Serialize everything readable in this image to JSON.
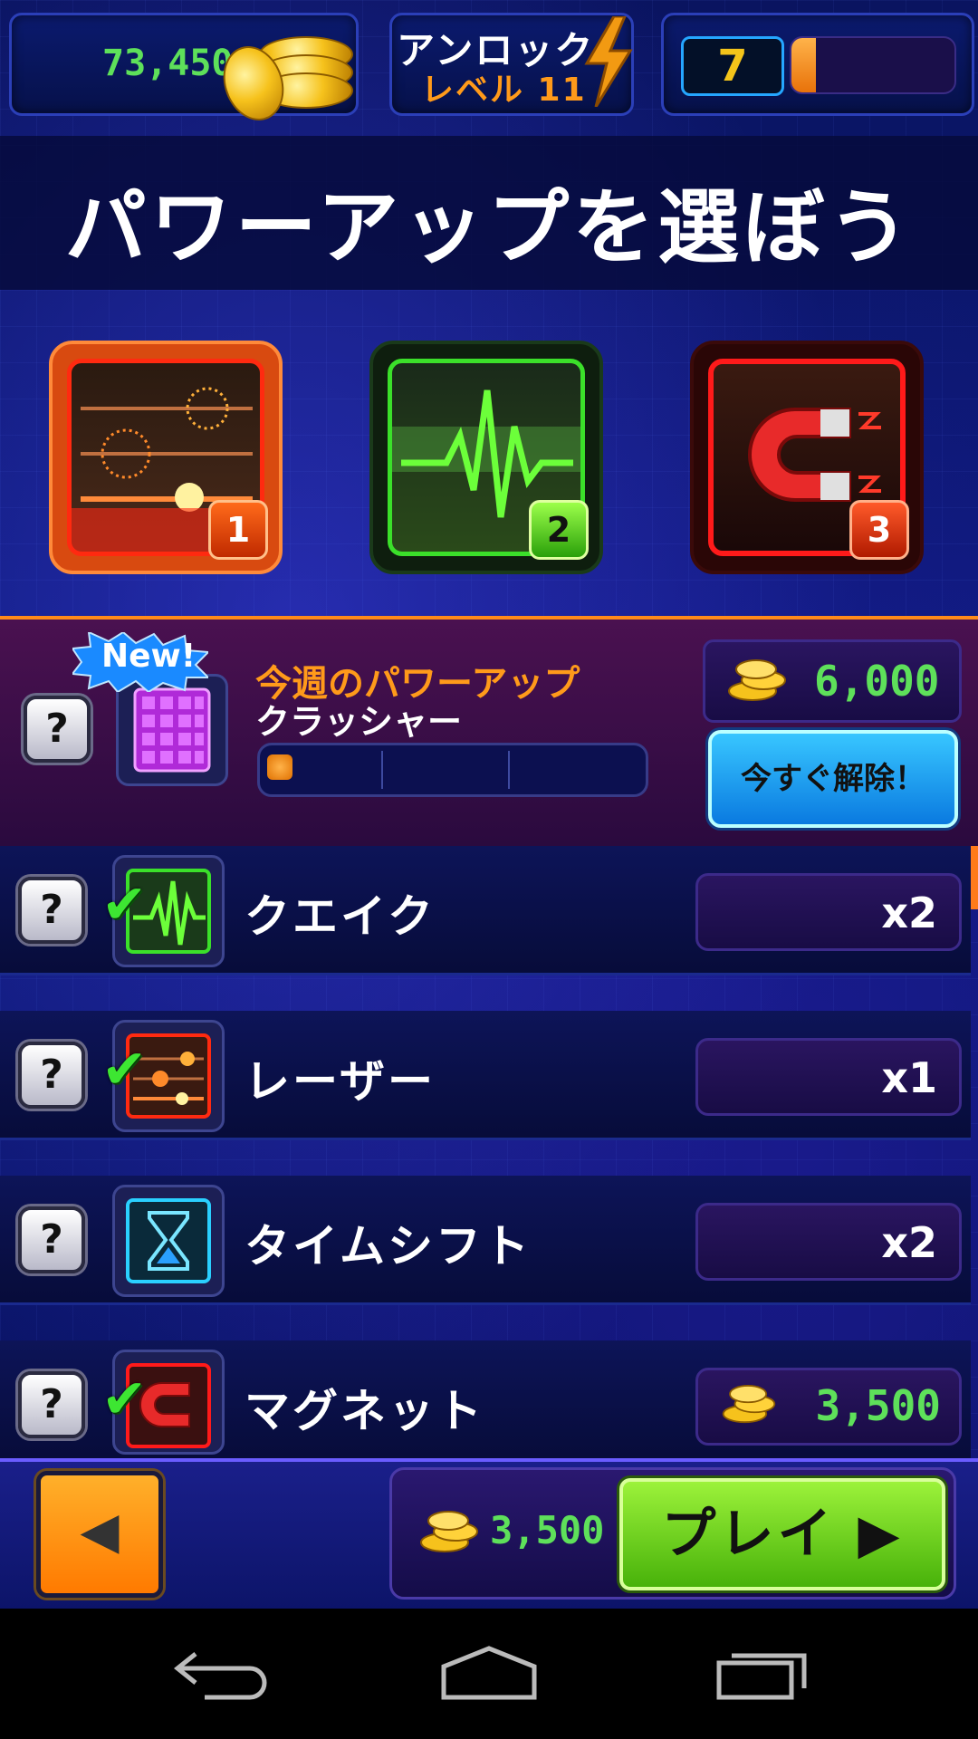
{
  "header": {
    "coins": "73,450",
    "unlock_label": "アンロック",
    "unlock_level": "レベル 11",
    "rank_number": "7",
    "xp_progress": 0.15
  },
  "title": "パワーアップを選ぼう",
  "slots": [
    {
      "number": "1",
      "icon": "laser-icon",
      "color": "#ff3a1a"
    },
    {
      "number": "2",
      "icon": "quake-icon",
      "color": "#3be02a"
    },
    {
      "number": "3",
      "icon": "magnet-icon",
      "color": "#ff1a1a"
    }
  ],
  "weekly": {
    "badge": "New!",
    "label": "今週のパワーアップ",
    "name": "クラッシャー",
    "price": "6,000",
    "unlock_button": "今すぐ解除！",
    "progress": 0.08
  },
  "powerups": [
    {
      "name": "クエイク",
      "count": "x2",
      "selected": true,
      "icon": "quake-icon"
    },
    {
      "name": "レーザー",
      "count": "x1",
      "selected": true,
      "icon": "laser-icon"
    },
    {
      "name": "タイムシフト",
      "count": "x2",
      "selected": false,
      "icon": "hourglass-icon"
    },
    {
      "name": "マグネット",
      "price": "3,500",
      "selected": true,
      "icon": "magnet-icon"
    }
  ],
  "footer": {
    "back_icon": "arrow-left-icon",
    "total_cost": "3,500",
    "play_label": "プレイ ▶"
  },
  "colors": {
    "accent_orange": "#ff9a1a",
    "coin_green": "#5ee05a",
    "unlock_blue": "#0a7ae0",
    "play_green": "#48b20a"
  }
}
